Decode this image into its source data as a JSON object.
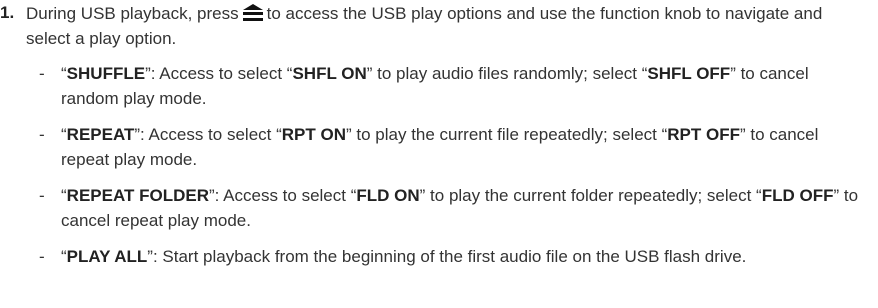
{
  "step": {
    "number": "1.",
    "text_before_icon": "During USB playback, press",
    "icon": "menu-icon",
    "text_after_icon": "to access the USB play options and use the function knob to navigate and select a play option."
  },
  "bullets": [
    {
      "dash": "-",
      "q1": "“",
      "name": "SHUFFLE",
      "t1": "”: Access to select “",
      "opt1": "SHFL ON",
      "t2": "” to play audio files randomly; select “",
      "opt2": "SHFL OFF",
      "t3": "” to cancel random play mode."
    },
    {
      "dash": "-",
      "q1": "“",
      "name": "REPEAT",
      "t1": "”: Access to select “",
      "opt1": "RPT ON",
      "t2": "” to play the current file repeatedly; select “",
      "opt2": "RPT OFF",
      "t3": "” to cancel repeat play mode."
    },
    {
      "dash": "-",
      "q1": "“",
      "name": "REPEAT FOLDER",
      "t1": "”: Access to select “",
      "opt1": "FLD ON",
      "t2": "” to play the current folder repeatedly; select “",
      "opt2": "FLD OFF",
      "t3": "” to cancel repeat play mode."
    },
    {
      "dash": "-",
      "q1": "“",
      "name": "PLAY ALL",
      "t1": "”: Start playback from the beginning of the first audio file on the USB flash drive."
    }
  ]
}
